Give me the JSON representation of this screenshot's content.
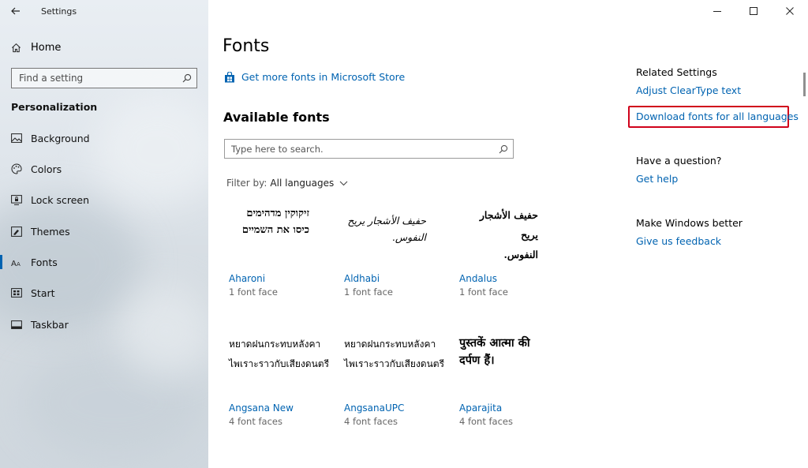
{
  "window": {
    "title": "Settings"
  },
  "sidebar": {
    "home_label": "Home",
    "search_placeholder": "Find a setting",
    "section_heading": "Personalization",
    "items": [
      {
        "label": "Background",
        "icon": "image-icon"
      },
      {
        "label": "Colors",
        "icon": "palette-icon"
      },
      {
        "label": "Lock screen",
        "icon": "lock-screen-icon"
      },
      {
        "label": "Themes",
        "icon": "brush-icon"
      },
      {
        "label": "Fonts",
        "icon": "fonts-icon",
        "active": true
      },
      {
        "label": "Start",
        "icon": "start-grid-icon"
      },
      {
        "label": "Taskbar",
        "icon": "taskbar-icon"
      }
    ]
  },
  "main": {
    "page_title": "Fonts",
    "store_link": "Get more fonts in Microsoft Store",
    "available_heading": "Available fonts",
    "search_placeholder": "Type here to search.",
    "filter_label": "Filter by:",
    "filter_value": "All languages",
    "fonts": [
      {
        "sample_lines": [
          "זיקוקין מדהימים",
          "כיסו את השמיים"
        ],
        "name": "Aharoni",
        "faces": "1 font face"
      },
      {
        "sample_lines": [
          "حفيف الأشجار يريح النفوس."
        ],
        "name": "Aldhabi",
        "faces": "1 font face"
      },
      {
        "sample_lines": [
          "حفيف الأشجار يريح",
          "النفوس."
        ],
        "name": "Andalus",
        "faces": "1 font face"
      },
      {
        "sample_lines": [
          "หยาดฝนกระทบหลังคา",
          "ไพเราะราวกับเสียงดนตรี"
        ],
        "name": "Angsana New",
        "faces": "4 font faces"
      },
      {
        "sample_lines": [
          "หยาดฝนกระทบหลังคา",
          "ไพเราะราวกับเสียงดนตรี"
        ],
        "name": "AngsanaUPC",
        "faces": "4 font faces"
      },
      {
        "sample_lines": [
          "पुस्तकें आत्मा की",
          "दर्पण हैं।"
        ],
        "name": "Aparajita",
        "faces": "4 font faces"
      }
    ]
  },
  "right_panel": {
    "related_heading": "Related Settings",
    "cleartype_link": "Adjust ClearType text",
    "download_link": "Download fonts for all languages",
    "question_heading": "Have a question?",
    "help_link": "Get help",
    "better_heading": "Make Windows better",
    "feedback_link": "Give us feedback"
  },
  "colors": {
    "accent": "#0063b1",
    "highlight": "#d0021b"
  }
}
